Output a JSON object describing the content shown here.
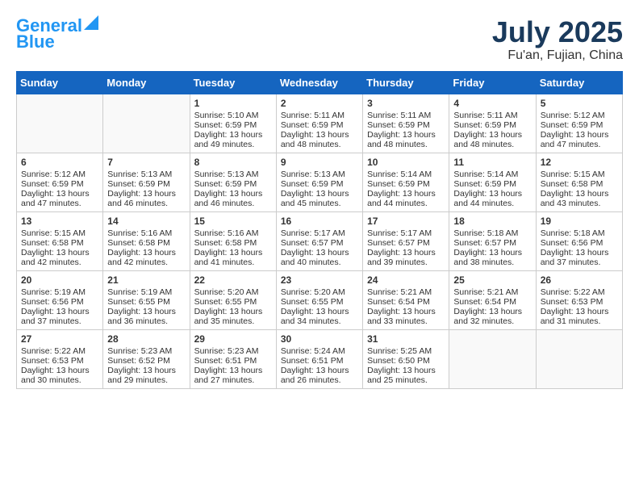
{
  "header": {
    "logo_line1": "General",
    "logo_line2": "Blue",
    "month_title": "July 2025",
    "location": "Fu'an, Fujian, China"
  },
  "weekdays": [
    "Sunday",
    "Monday",
    "Tuesday",
    "Wednesday",
    "Thursday",
    "Friday",
    "Saturday"
  ],
  "weeks": [
    [
      {
        "day": "",
        "empty": true
      },
      {
        "day": "",
        "empty": true
      },
      {
        "day": "1",
        "sunrise": "5:10 AM",
        "sunset": "6:59 PM",
        "daylight": "13 hours and 49 minutes."
      },
      {
        "day": "2",
        "sunrise": "5:11 AM",
        "sunset": "6:59 PM",
        "daylight": "13 hours and 48 minutes."
      },
      {
        "day": "3",
        "sunrise": "5:11 AM",
        "sunset": "6:59 PM",
        "daylight": "13 hours and 48 minutes."
      },
      {
        "day": "4",
        "sunrise": "5:11 AM",
        "sunset": "6:59 PM",
        "daylight": "13 hours and 48 minutes."
      },
      {
        "day": "5",
        "sunrise": "5:12 AM",
        "sunset": "6:59 PM",
        "daylight": "13 hours and 47 minutes."
      }
    ],
    [
      {
        "day": "6",
        "sunrise": "5:12 AM",
        "sunset": "6:59 PM",
        "daylight": "13 hours and 47 minutes."
      },
      {
        "day": "7",
        "sunrise": "5:13 AM",
        "sunset": "6:59 PM",
        "daylight": "13 hours and 46 minutes."
      },
      {
        "day": "8",
        "sunrise": "5:13 AM",
        "sunset": "6:59 PM",
        "daylight": "13 hours and 46 minutes."
      },
      {
        "day": "9",
        "sunrise": "5:13 AM",
        "sunset": "6:59 PM",
        "daylight": "13 hours and 45 minutes."
      },
      {
        "day": "10",
        "sunrise": "5:14 AM",
        "sunset": "6:59 PM",
        "daylight": "13 hours and 44 minutes."
      },
      {
        "day": "11",
        "sunrise": "5:14 AM",
        "sunset": "6:59 PM",
        "daylight": "13 hours and 44 minutes."
      },
      {
        "day": "12",
        "sunrise": "5:15 AM",
        "sunset": "6:58 PM",
        "daylight": "13 hours and 43 minutes."
      }
    ],
    [
      {
        "day": "13",
        "sunrise": "5:15 AM",
        "sunset": "6:58 PM",
        "daylight": "13 hours and 42 minutes."
      },
      {
        "day": "14",
        "sunrise": "5:16 AM",
        "sunset": "6:58 PM",
        "daylight": "13 hours and 42 minutes."
      },
      {
        "day": "15",
        "sunrise": "5:16 AM",
        "sunset": "6:58 PM",
        "daylight": "13 hours and 41 minutes."
      },
      {
        "day": "16",
        "sunrise": "5:17 AM",
        "sunset": "6:57 PM",
        "daylight": "13 hours and 40 minutes."
      },
      {
        "day": "17",
        "sunrise": "5:17 AM",
        "sunset": "6:57 PM",
        "daylight": "13 hours and 39 minutes."
      },
      {
        "day": "18",
        "sunrise": "5:18 AM",
        "sunset": "6:57 PM",
        "daylight": "13 hours and 38 minutes."
      },
      {
        "day": "19",
        "sunrise": "5:18 AM",
        "sunset": "6:56 PM",
        "daylight": "13 hours and 37 minutes."
      }
    ],
    [
      {
        "day": "20",
        "sunrise": "5:19 AM",
        "sunset": "6:56 PM",
        "daylight": "13 hours and 37 minutes."
      },
      {
        "day": "21",
        "sunrise": "5:19 AM",
        "sunset": "6:55 PM",
        "daylight": "13 hours and 36 minutes."
      },
      {
        "day": "22",
        "sunrise": "5:20 AM",
        "sunset": "6:55 PM",
        "daylight": "13 hours and 35 minutes."
      },
      {
        "day": "23",
        "sunrise": "5:20 AM",
        "sunset": "6:55 PM",
        "daylight": "13 hours and 34 minutes."
      },
      {
        "day": "24",
        "sunrise": "5:21 AM",
        "sunset": "6:54 PM",
        "daylight": "13 hours and 33 minutes."
      },
      {
        "day": "25",
        "sunrise": "5:21 AM",
        "sunset": "6:54 PM",
        "daylight": "13 hours and 32 minutes."
      },
      {
        "day": "26",
        "sunrise": "5:22 AM",
        "sunset": "6:53 PM",
        "daylight": "13 hours and 31 minutes."
      }
    ],
    [
      {
        "day": "27",
        "sunrise": "5:22 AM",
        "sunset": "6:53 PM",
        "daylight": "13 hours and 30 minutes."
      },
      {
        "day": "28",
        "sunrise": "5:23 AM",
        "sunset": "6:52 PM",
        "daylight": "13 hours and 29 minutes."
      },
      {
        "day": "29",
        "sunrise": "5:23 AM",
        "sunset": "6:51 PM",
        "daylight": "13 hours and 27 minutes."
      },
      {
        "day": "30",
        "sunrise": "5:24 AM",
        "sunset": "6:51 PM",
        "daylight": "13 hours and 26 minutes."
      },
      {
        "day": "31",
        "sunrise": "5:25 AM",
        "sunset": "6:50 PM",
        "daylight": "13 hours and 25 minutes."
      },
      {
        "day": "",
        "empty": true
      },
      {
        "day": "",
        "empty": true
      }
    ]
  ],
  "labels": {
    "sunrise_prefix": "Sunrise: ",
    "sunset_prefix": "Sunset: ",
    "daylight_prefix": "Daylight: "
  }
}
